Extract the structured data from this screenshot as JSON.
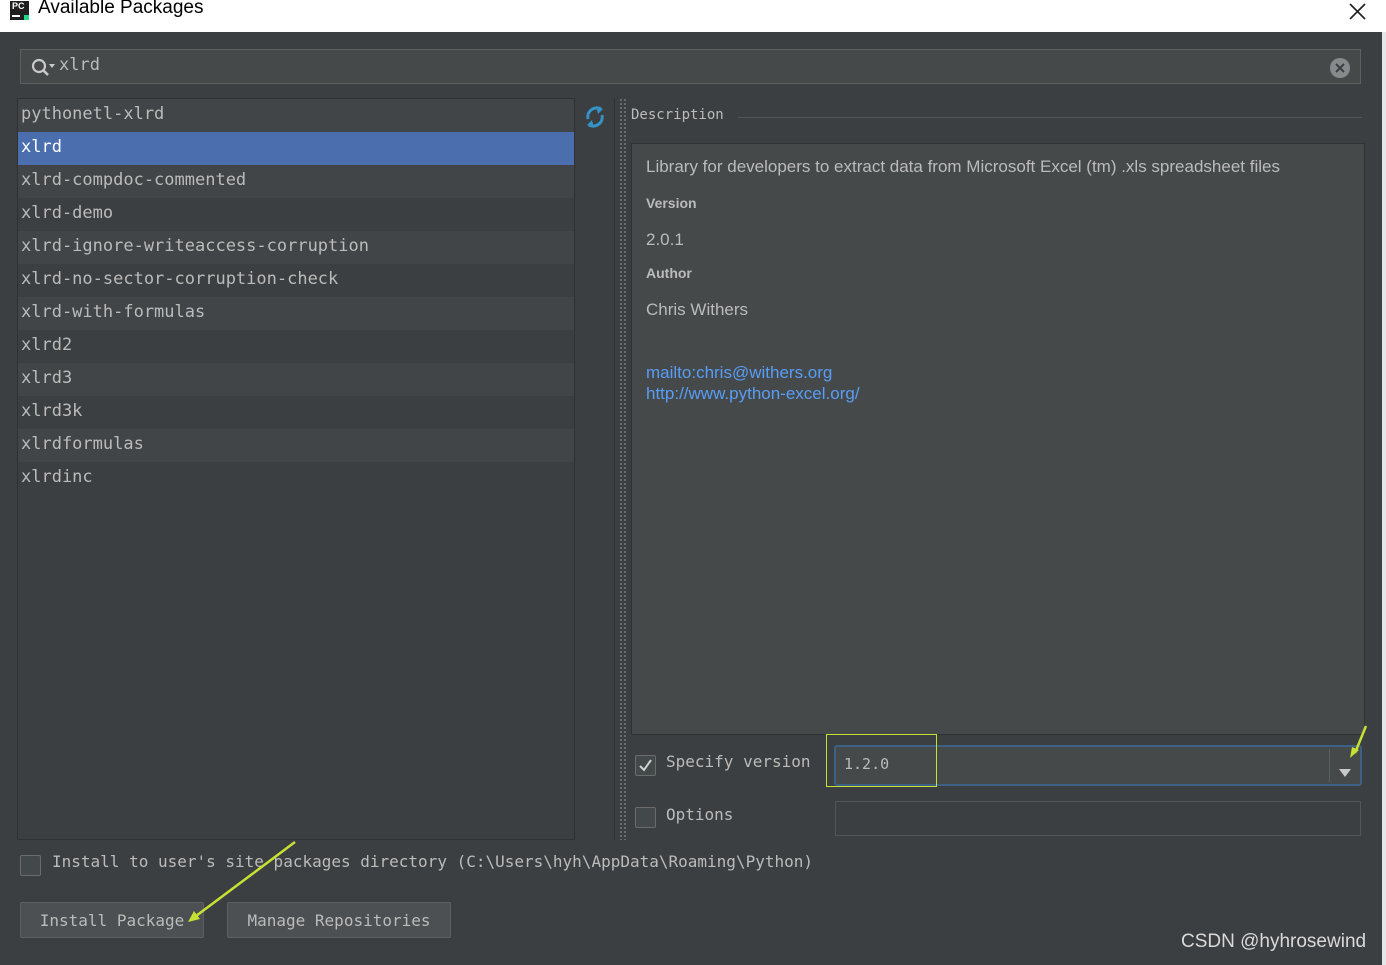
{
  "window": {
    "title": "Available Packages",
    "app_icon_text": "PC"
  },
  "search": {
    "query": "xlrd"
  },
  "packages": [
    "pythonetl-xlrd",
    "xlrd",
    "xlrd-compdoc-commented",
    "xlrd-demo",
    "xlrd-ignore-writeaccess-corruption",
    "xlrd-no-sector-corruption-check",
    "xlrd-with-formulas",
    "xlrd2",
    "xlrd3",
    "xlrd3k",
    "xlrdformulas",
    "xlrdinc"
  ],
  "selected_package": "xlrd",
  "description": {
    "label": "Description",
    "summary": "Library for developers to extract data from Microsoft Excel (tm) .xls spreadsheet files",
    "version_label": "Version",
    "version": "2.0.1",
    "author_label": "Author",
    "author": "Chris Withers",
    "links": [
      "mailto:chris@withers.org",
      "http://www.python-excel.org/"
    ]
  },
  "options": {
    "specify_version_label": "Specify version",
    "specify_version_checked": true,
    "version_value": "1.2.0",
    "options_label": "Options",
    "options_checked": false,
    "options_value": "",
    "user_site_label": "Install to user's site packages directory (C:\\Users\\hyh\\AppData\\Roaming\\Python)",
    "user_site_checked": false
  },
  "buttons": {
    "install": "Install Package",
    "manage": "Manage Repositories"
  },
  "watermark": "CSDN @hyhrosewind",
  "colors": {
    "background": "#3c3f41",
    "selection": "#4b6eaf",
    "link": "#589df6",
    "annotation": "#c6e033"
  }
}
